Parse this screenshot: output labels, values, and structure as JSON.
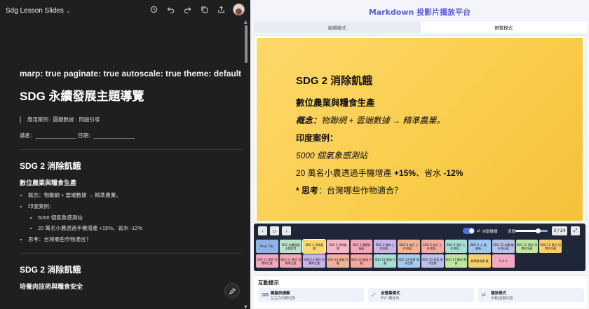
{
  "left": {
    "doc_title": "Sdg Lesson Slides",
    "frontmatter": "marp: true paginate: true autoscale: true theme: default",
    "h1": "SDG 永續發展主題導覽",
    "blockquote": "應用案例 · 圖鍵數據 · 問題引導",
    "signature": "講者：______________ 日期：______________",
    "sections": [
      {
        "h2": "SDG 2 消除飢餓",
        "h3": "數位農業與糧食生產",
        "items": [
          {
            "text": "概念：物聯網 + 雲端數據 → 精準農業。",
            "sub": []
          },
          {
            "text": "印度案例：",
            "sub": [
              "5000 個氣象感測站",
              "20 萬名小農透過手機增產 +15%、省水 -12%"
            ]
          },
          {
            "text": "思考：台灣哪些作物適合？",
            "sub": []
          }
        ]
      },
      {
        "h2": "SDG 2 消除飢餓",
        "h3": "培養肉技術與糧食安全",
        "items": []
      }
    ]
  },
  "right": {
    "app_title": "Markdown 投影片播放平台",
    "tabs": [
      "編輯模式",
      "預覽模式"
    ],
    "active_tab": 1,
    "slide": {
      "h2": "SDG 2 消除飢餓",
      "h3": "數位農業與糧食生產",
      "concept_label": "概念：",
      "concept_text": "物聯網 + 雲端數據 → 精準農業。",
      "case_label": "印度案例：",
      "stations": "5000 個氣象感測站",
      "farmers_pre": "20 萬名小農透過手機增產 ",
      "farmers_up": "+15%",
      "farmers_mid": "、省水 ",
      "farmers_down": "-12%",
      "think_label": "* 思考",
      "think_text": "：台灣哪些作物適合？"
    },
    "controls": {
      "prev": "‹",
      "play": "▷",
      "next": "›",
      "auto_label": "自動輪播",
      "speed_label": "速度:",
      "speed": 0.7,
      "counter": "3 / 24",
      "fullscreen": "⤢"
    },
    "thumbnails": [
      {
        "label": "Marp Title",
        "color": "#8fb3e8"
      },
      {
        "label": "SDG 永續發展主題導覽",
        "color": "#b9e4c9"
      },
      {
        "label": "SDG 2 消除飢餓",
        "color": "#fdd86b"
      },
      {
        "label": "SDG 2 消除飢餓",
        "color": "#f5b7c8"
      },
      {
        "label": "SDG 3 健康與福祉",
        "color": "#f2a7b9"
      },
      {
        "label": "SDG 4 教育 工作與經…",
        "color": "#c9b5ea"
      },
      {
        "label": "SDG 8 良好 工作與經…",
        "color": "#f0b394"
      },
      {
        "label": "SDG 8 良好 工作與經…",
        "color": "#f3aba2"
      },
      {
        "label": "SDG 8 良好 工作與經…",
        "color": "#a8dfd5"
      },
      {
        "label": "SDG 9 工 業、創新…",
        "color": "#9fc6ee"
      },
      {
        "label": "SDG 11 永續 城市與社區",
        "color": "#b9c1ea"
      },
      {
        "label": "SDG 12 責任 消費與生產",
        "color": "#bfe6a3"
      },
      {
        "label": "SDG 12 責任 消費與生產",
        "color": "#f9cf6b"
      },
      {
        "label": "SDG 12 責任 消費與生產",
        "color": "#f3a8c0"
      },
      {
        "label": "SDG 12 責任 消費與生產",
        "color": "#f2a9b4"
      },
      {
        "label": "SDG 12 責任 消費與生產",
        "color": "#c6b4ea"
      },
      {
        "label": "SDG 13 氣候 行動",
        "color": "#f1b19b"
      },
      {
        "label": "SDG 13 氣候 行動",
        "color": "#f2a7a3"
      },
      {
        "label": "SDG 13 氣候 行動",
        "color": "#a6ddd4"
      },
      {
        "label": "SDG 14 保育 海洋生態",
        "color": "#a7c9ee"
      },
      {
        "label": "SDG 14 保育 海洋生態",
        "color": "#b9c0ea"
      },
      {
        "label": "SDG 17 夥伴 關係",
        "color": "#bfe5a2"
      },
      {
        "label": "教學應用建 議",
        "color": "#f9cf6b"
      },
      {
        "label": "Q & A",
        "color": "#f4a9c2"
      }
    ],
    "hints": {
      "title": "互動提示",
      "cards": [
        {
          "icon": "⌨",
          "t1": "鍵盤快捷鍵",
          "t2": "左右方向鍵切換"
        },
        {
          "icon": "⤢",
          "t1": "全螢幕模式",
          "t2": "ESC 鍵退出"
        },
        {
          "icon": "⇄",
          "t1": "播放模式",
          "t2": "手動/自動切換"
        }
      ]
    }
  }
}
